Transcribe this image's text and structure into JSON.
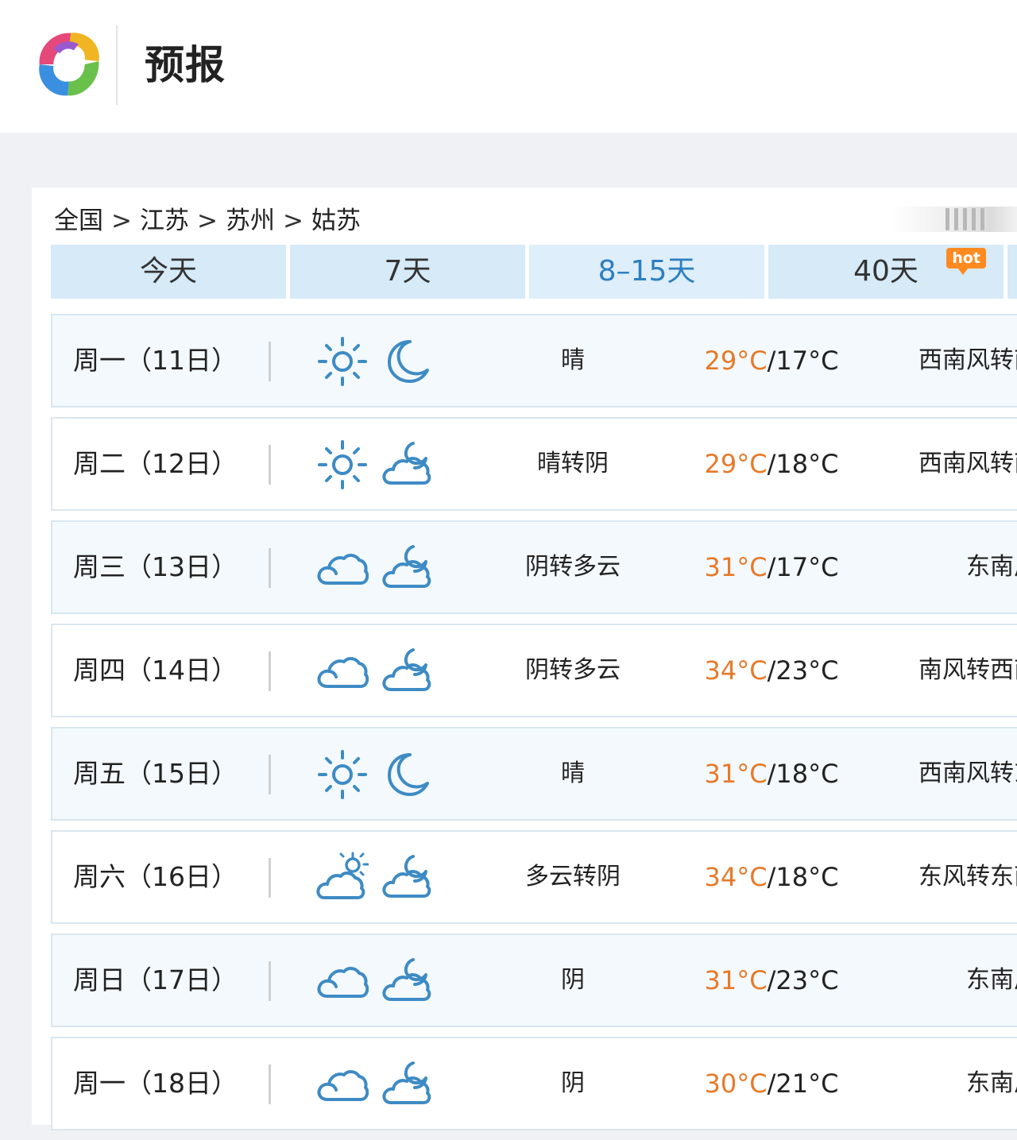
{
  "header": {
    "title": "预报"
  },
  "breadcrumb": [
    "全国",
    "江苏",
    "苏州",
    "姑苏"
  ],
  "breadcrumb_separator": ">",
  "tabs": [
    {
      "label": "今天",
      "active": false
    },
    {
      "label": "7天",
      "active": false
    },
    {
      "label": "8–15天",
      "active": true
    },
    {
      "label": "40天",
      "active": false,
      "badge": "hot"
    }
  ],
  "colors": {
    "accent": "#2c7fc0",
    "tab_bg": "#d6eaf8",
    "high_temp": "#e67a2a",
    "icon_stroke": "#3e8bc4",
    "sun": "#2c7fc0"
  },
  "forecast": [
    {
      "day": "周一（11日）",
      "icon_day": "sun-icon",
      "icon_night": "moon-icon",
      "condition": "晴",
      "high": "29°C",
      "sep": "/",
      "low": "17°C",
      "wind": "西南风转南"
    },
    {
      "day": "周二（12日）",
      "icon_day": "sun-icon",
      "icon_night": "cloud-moon-icon",
      "condition": "晴转阴",
      "high": "29°C",
      "sep": "/",
      "low": "18°C",
      "wind": "西南风转南"
    },
    {
      "day": "周三（13日）",
      "icon_day": "cloud-icon",
      "icon_night": "cloud-moon-icon",
      "condition": "阴转多云",
      "high": "31°C",
      "sep": "/",
      "low": "17°C",
      "wind": "东南风"
    },
    {
      "day": "周四（14日）",
      "icon_day": "cloud-icon",
      "icon_night": "cloud-moon-icon",
      "condition": "阴转多云",
      "high": "34°C",
      "sep": "/",
      "low": "23°C",
      "wind": "南风转西南"
    },
    {
      "day": "周五（15日）",
      "icon_day": "sun-icon",
      "icon_night": "moon-icon",
      "condition": "晴",
      "high": "31°C",
      "sep": "/",
      "low": "18°C",
      "wind": "西南风转东"
    },
    {
      "day": "周六（16日）",
      "icon_day": "cloud-sun-icon",
      "icon_night": "cloud-moon-icon",
      "condition": "多云转阴",
      "high": "34°C",
      "sep": "/",
      "low": "18°C",
      "wind": "东风转东南"
    },
    {
      "day": "周日（17日）",
      "icon_day": "cloud-icon",
      "icon_night": "cloud-moon-icon",
      "condition": "阴",
      "high": "31°C",
      "sep": "/",
      "low": "23°C",
      "wind": "东南风"
    },
    {
      "day": "周一（18日）",
      "icon_day": "cloud-icon",
      "icon_night": "cloud-moon-icon",
      "condition": "阴",
      "high": "30°C",
      "sep": "/",
      "low": "21°C",
      "wind": "东南风"
    }
  ]
}
